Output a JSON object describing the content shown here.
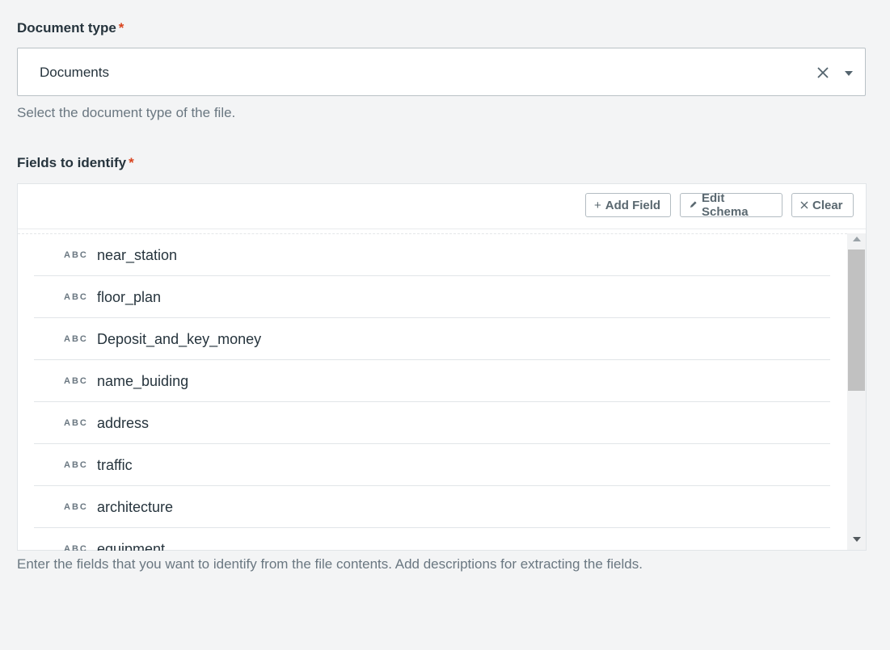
{
  "document_type": {
    "label": "Document type",
    "required_mark": "*",
    "selected_value": "Documents",
    "hint": "Select the document type of the file."
  },
  "fields": {
    "label": "Fields to identify",
    "required_mark": "*",
    "toolbar": {
      "add_field_label": "Add Field",
      "edit_schema_label": "Edit Schema",
      "clear_label": "Clear"
    },
    "items": [
      {
        "type": "ABC",
        "name": "near_station"
      },
      {
        "type": "ABC",
        "name": "floor_plan"
      },
      {
        "type": "ABC",
        "name": "Deposit_and_key_money"
      },
      {
        "type": "ABC",
        "name": "name_buiding"
      },
      {
        "type": "ABC",
        "name": "address"
      },
      {
        "type": "ABC",
        "name": "traffic"
      },
      {
        "type": "ABC",
        "name": "architecture"
      },
      {
        "type": "ABC",
        "name": "equipment"
      }
    ],
    "hint": "Enter the fields that you want to identify from the file contents. Add descriptions for extracting the fields."
  },
  "icons": {
    "clear": "close-icon",
    "dropdown": "caret-down-icon",
    "add": "plus-icon",
    "edit": "pencil-icon",
    "clear_fields": "close-icon"
  },
  "colors": {
    "required": "#d9441e",
    "background": "#f3f4f5"
  }
}
